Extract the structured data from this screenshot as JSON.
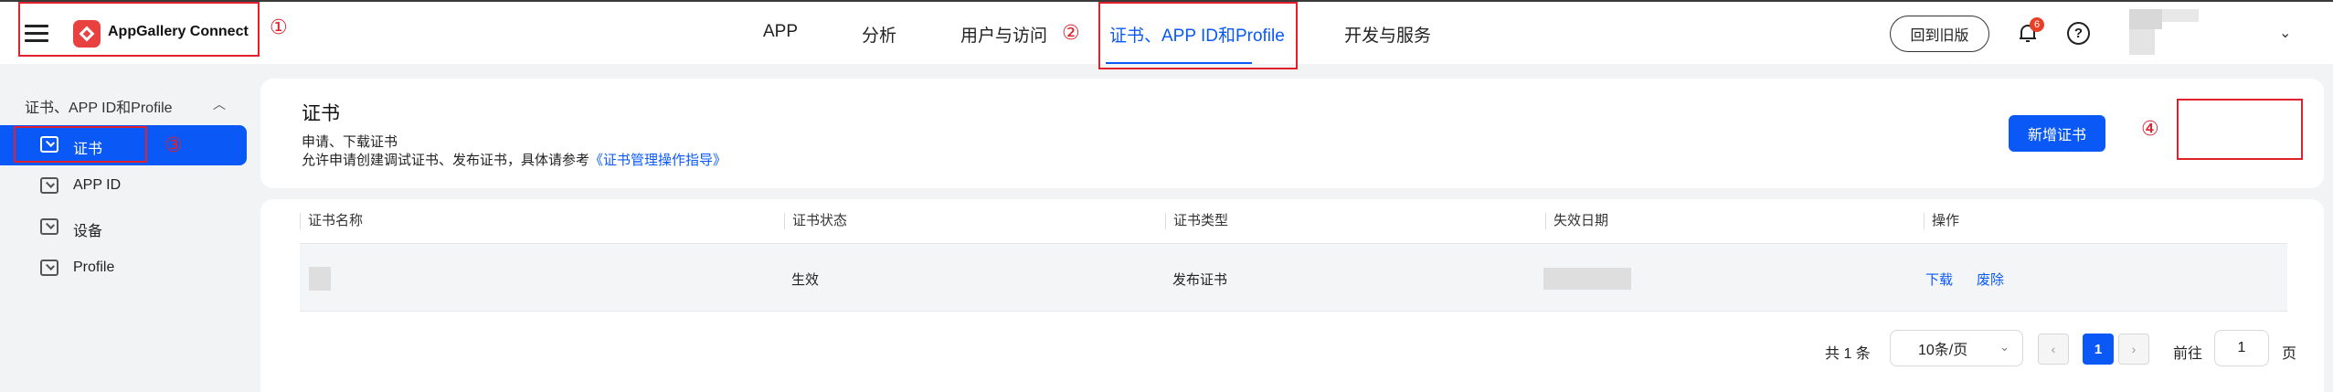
{
  "header": {
    "brand": "AppGallery Connect",
    "nav": [
      "APP",
      "分析",
      "用户与访问",
      "证书、APP ID和Profile",
      "开发与服务"
    ],
    "old_version": "回到旧版",
    "notify_count": "6",
    "help_glyph": "?",
    "user_chevron": "⌄"
  },
  "annotations": [
    "①",
    "②",
    "③",
    "④"
  ],
  "sidebar": {
    "group": "证书、APP ID和Profile",
    "collapse_glyph": "︿",
    "items": [
      {
        "label": "证书"
      },
      {
        "label": "APP ID"
      },
      {
        "label": "设备"
      },
      {
        "label": "Profile"
      }
    ]
  },
  "page": {
    "title": "证书",
    "desc1": "申请、下载证书",
    "desc2_prefix": "允许申请创建调试证书、发布证书，具体请参考",
    "desc2_link": "《证书管理操作指导》",
    "add_button": "新增证书"
  },
  "table": {
    "columns": [
      "证书名称",
      "证书状态",
      "证书类型",
      "失效日期",
      "操作"
    ],
    "rows": [
      {
        "status": "生效",
        "type": "发布证书",
        "actions": [
          "下载",
          "废除"
        ]
      }
    ]
  },
  "pagination": {
    "total": "共 1 条",
    "page_size": "10条/页",
    "size_chevron": "⌄",
    "prev": "‹",
    "current": "1",
    "next": "›",
    "goto_label": "前往",
    "goto_value": "1",
    "page_label": "页"
  },
  "colors": {
    "accent": "#0a59f7",
    "annotation": "#e0202a",
    "badge": "#e84026"
  }
}
